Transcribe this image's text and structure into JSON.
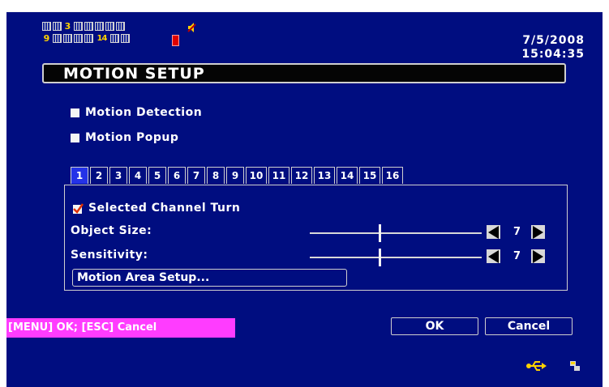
{
  "status": {
    "channel_row1": [
      "",
      "",
      "3",
      "",
      "",
      "",
      "",
      ""
    ],
    "channel_row2": [
      "9",
      "",
      "",
      "",
      "",
      "14",
      "",
      ""
    ],
    "date": "7/5/2008",
    "time": "15:04:35"
  },
  "header": {
    "title": "MOTION SETUP"
  },
  "options": {
    "motion_detection": "Motion Detection",
    "motion_popup": "Motion Popup"
  },
  "tabs": [
    "1",
    "2",
    "3",
    "4",
    "5",
    "6",
    "7",
    "8",
    "9",
    "10",
    "11",
    "12",
    "13",
    "14",
    "15",
    "16"
  ],
  "active_tab": "1",
  "panel": {
    "selected_channel_turn": "Selected Channel Turn",
    "object_size_label": "Object Size:",
    "object_size_value": "7",
    "sensitivity_label": "Sensitivity:",
    "sensitivity_value": "7",
    "motion_area_button": "Motion Area Setup..."
  },
  "footer": {
    "hint": "[MENU] OK; [ESC] Cancel",
    "ok": "OK",
    "cancel": "Cancel"
  },
  "colors": {
    "background": "#000d80",
    "active_tab": "#2432e8",
    "hint_bg": "#ff3cff",
    "channel_active": "#ffd200"
  },
  "icons": [
    "speaker-icon",
    "record-icon",
    "usb-icon",
    "network-icon",
    "checked-mark-icon"
  ]
}
